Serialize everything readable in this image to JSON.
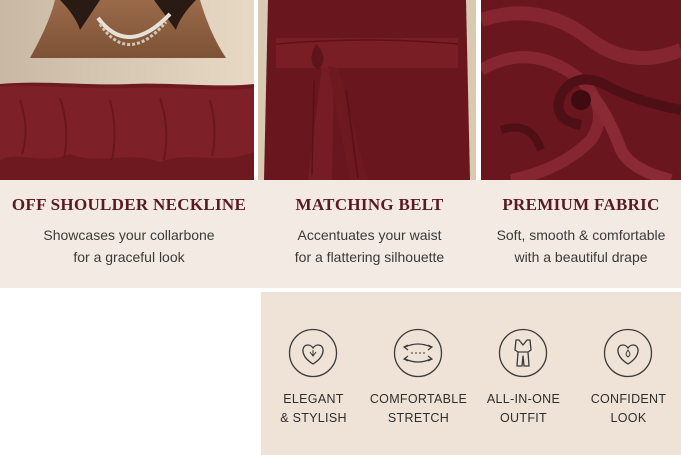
{
  "features": [
    {
      "title": "OFF SHOULDER NECKLINE",
      "description": "Showcases your collarbone\nfor a graceful look",
      "image": "off-shoulder-ruffle-neckline-photo"
    },
    {
      "title": "MATCHING BELT",
      "description": "Accentuates your waist\nfor a flattering silhouette",
      "image": "tied-waist-belt-photo"
    },
    {
      "title": "PREMIUM FABRIC",
      "description": "Soft, smooth & comfortable\nwith a beautiful drape",
      "image": "draped-fabric-closeup-photo"
    }
  ],
  "benefits": [
    {
      "line1": "ELEGANT",
      "line2": "& STYLISH",
      "icon": "heart-badge-icon"
    },
    {
      "line1": "COMFORTABLE",
      "line2": "STRETCH",
      "icon": "stretch-arrows-icon"
    },
    {
      "line1": "ALL-IN-ONE",
      "line2": "OUTFIT",
      "icon": "jumpsuit-icon"
    },
    {
      "line1": "CONFIDENT",
      "line2": "LOOK",
      "icon": "heart-drop-icon"
    }
  ],
  "colors": {
    "dress": "#6e1820",
    "title": "#5a1a22",
    "caption_bg": "#f3ebe3",
    "benefit_bg": "#efe3d7"
  }
}
